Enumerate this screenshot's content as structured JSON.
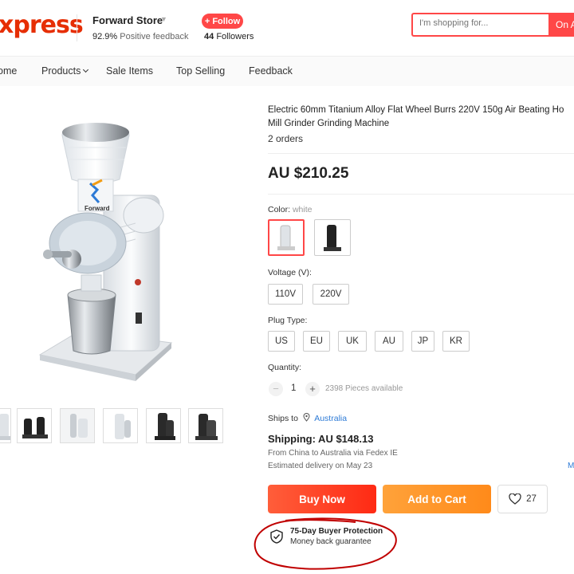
{
  "header": {
    "logo_text": "xpress",
    "store_name": "Forward Store",
    "feedback_pct": "92.9%",
    "feedback_label": "Positive feedback",
    "follow_label": "+ Follow",
    "followers_count": "44",
    "followers_label": "Followers",
    "search_placeholder": "I'm shopping for...",
    "search_button": "On A"
  },
  "nav": {
    "items": [
      {
        "label": "ome"
      },
      {
        "label": "Products"
      },
      {
        "label": "Sale Items"
      },
      {
        "label": "Top Selling"
      },
      {
        "label": "Feedback"
      }
    ]
  },
  "gallery": {
    "brand_watermark": "Forward",
    "thumbnail_count": 6
  },
  "product": {
    "title_line1": "Electric 60mm Titanium Alloy Flat Wheel Burrs 220V 150g Air Beating Ho",
    "title_line2": "Mill Grinder Grinding Machine",
    "orders": "2 orders",
    "price": "AU $210.25",
    "color_label": "Color:",
    "color_value": "white",
    "voltage_label": "Voltage (V):",
    "voltage_options": [
      "110V",
      "220V"
    ],
    "plug_label": "Plug Type:",
    "plug_options": [
      "US",
      "EU",
      "UK",
      "AU",
      "JP",
      "KR"
    ],
    "quantity_label": "Quantity:",
    "quantity_value": "1",
    "quantity_minus": "−",
    "quantity_plus": "+",
    "available": "2398 Pieces available"
  },
  "shipping": {
    "ships_to_label": "Ships to",
    "ships_to_location": "Australia",
    "price_line": "Shipping: AU $148.13",
    "from_line": "From China to Australia via Fedex IE",
    "estimate_line": "Estimated delivery on May 23",
    "more_link": "M"
  },
  "actions": {
    "buy_now": "Buy Now",
    "add_to_cart": "Add to Cart",
    "wishlist_count": "27"
  },
  "protection": {
    "title": "75-Day Buyer Protection",
    "subtitle": "Money back guarantee"
  },
  "colors": {
    "brand_red": "#ff4747",
    "logo_red": "#e62e04",
    "cart_orange": "#ff8a1a",
    "link_blue": "#2e7bd6",
    "annotation_red": "#c00000"
  }
}
